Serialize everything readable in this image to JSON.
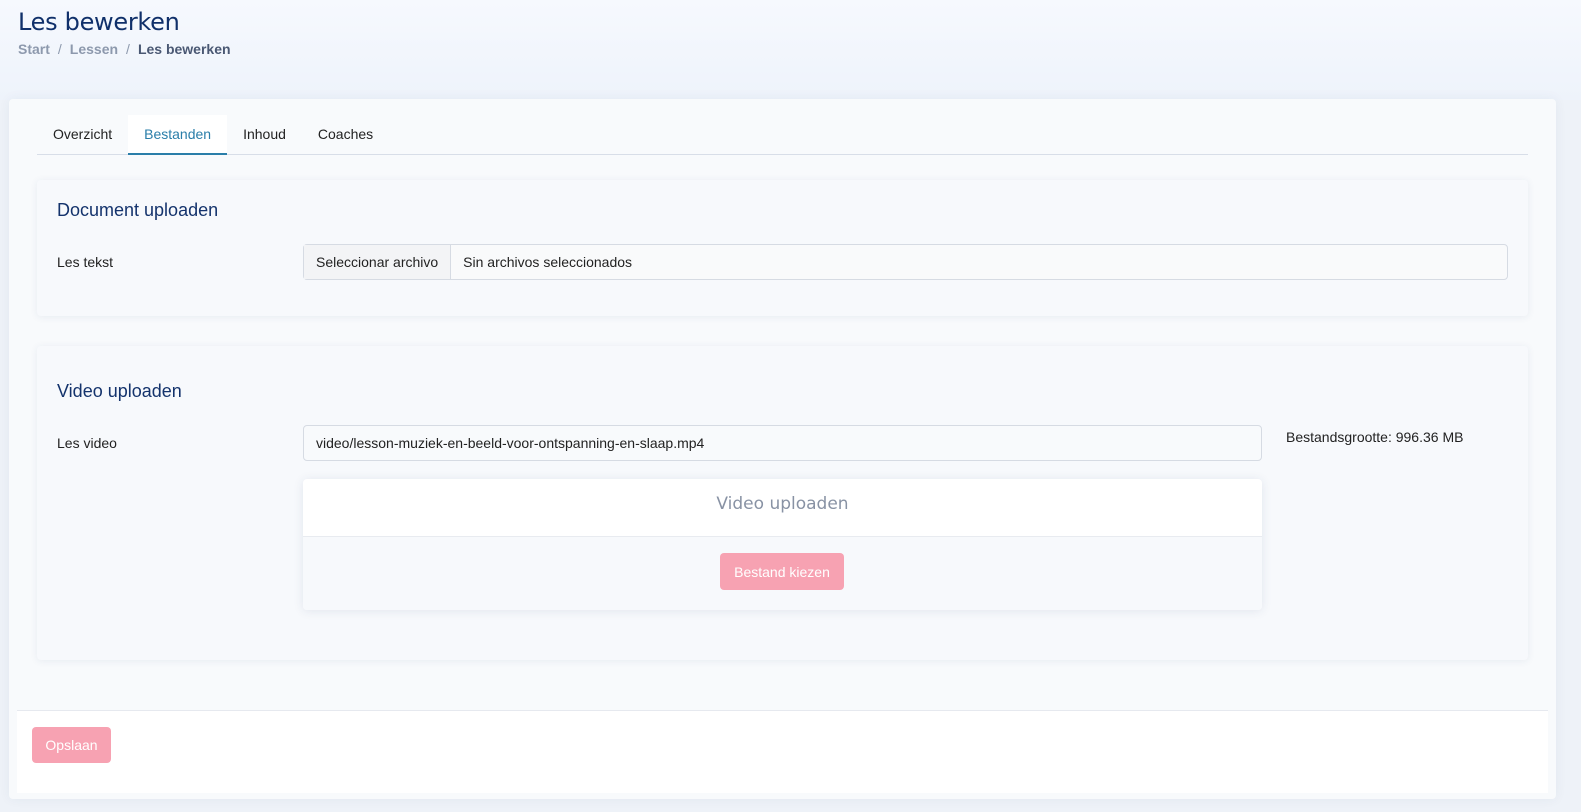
{
  "header": {
    "title": "Les bewerken",
    "breadcrumb": [
      "Start",
      "Lessen",
      "Les bewerken"
    ],
    "separator": "/"
  },
  "tabs": [
    {
      "label": "Overzicht",
      "active": false
    },
    {
      "label": "Bestanden",
      "active": true
    },
    {
      "label": "Inhoud",
      "active": false
    },
    {
      "label": "Coaches",
      "active": false
    }
  ],
  "document_section": {
    "title": "Document uploaden",
    "field_label": "Les tekst",
    "file_button": "Seleccionar archivo",
    "file_status": "Sin archivos seleccionados"
  },
  "video_section": {
    "title": "Video uploaden",
    "field_label": "Les video",
    "path_value": "video/lesson-muziek-en-beeld-voor-ontspanning-en-slaap.mp4",
    "filesize": "Bestandsgrootte: 996.36 MB",
    "uploader_title": "Video uploaden",
    "choose_button": "Bestand kiezen"
  },
  "footer": {
    "save_button": "Opslaan"
  },
  "colors": {
    "accent": "#2a7ea9",
    "title": "#10306a",
    "button_pink": "#f7a2b2"
  }
}
